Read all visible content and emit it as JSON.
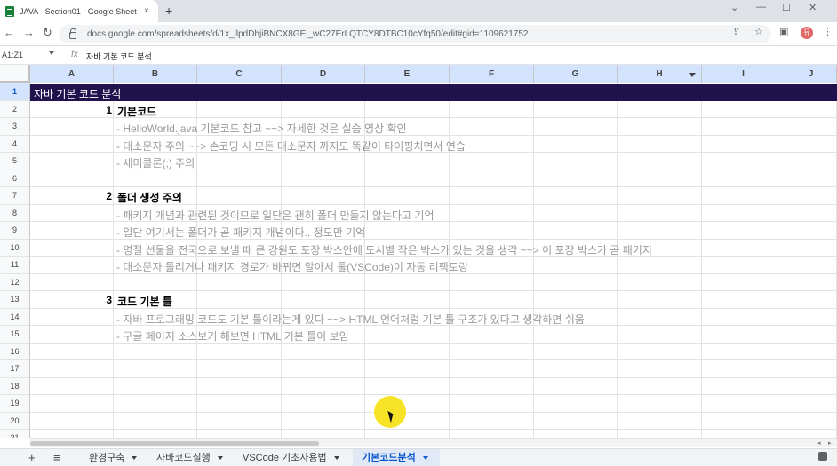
{
  "browser": {
    "tab_title": "JAVA - Section01 - Google Sheets",
    "tab_close": "×",
    "new_tab": "+",
    "url": "docs.google.com/spreadsheets/d/1x_llpdDhjiBNCX8GEi_wC27ErLQTCY8DTBC10cYfq50/edit#gid=1109621752",
    "profile_initial": "뮤"
  },
  "formula_bar": {
    "name_box": "A1:Z1",
    "fx": "fx",
    "value": "자바 기본 코드 분석"
  },
  "columns": [
    "A",
    "B",
    "C",
    "D",
    "E",
    "F",
    "G",
    "H",
    "I",
    "J"
  ],
  "rows": [
    "1",
    "2",
    "3",
    "4",
    "5",
    "6",
    "7",
    "8",
    "9",
    "10",
    "11",
    "12",
    "13",
    "14",
    "15",
    "16",
    "17",
    "18",
    "19",
    "20",
    "21"
  ],
  "sheet": {
    "title": "자바 기본 코드 분석",
    "sections": [
      {
        "number": "1",
        "heading": "기본코드",
        "items": [
          "- HelloWorld.java 기본코드 참고 ~~> 자세한 것은 실습 영상 확인",
          "- 대소문자 주의 ~~> 손코딩 시 모든 대소문자 까지도 똑같이 타이핑치면서 연습",
          "- 세미콜론(;) 주의"
        ]
      },
      {
        "number": "2",
        "heading": "폴더 생성 주의",
        "items": [
          "- 패키지 개념과 관련된 것이므로 일단은 괜히 폴더 만들지 않는다고 기억",
          "- 일단 여기서는 폴더가 곧 패키지 개념이다.. 정도만 기억",
          "- 명절 선물을 전국으로 보낼 때 큰 강원도 포장 박스안에 도시별 작은 박스가 있는 것을 생각 ~~> 이 포장 박스가 곧 패키지",
          "- 대소문자 틀리거나 패키지 경로가 바뀌면 알아서 툴(VSCode)이 자동 리팩토링"
        ]
      },
      {
        "number": "3",
        "heading": "코드 기본 틀",
        "items": [
          "- 자바 프로그래밍 코드도 기본 틀이라는게 있다 ~~> HTML 언어처럼 기본 틀 구조가 있다고 생각하면 쉬움",
          "- 구글 페이지 소스보기 해보면 HTML 기본 틀이 보임"
        ]
      }
    ]
  },
  "sheet_tabs": [
    {
      "label": "환경구축",
      "active": false
    },
    {
      "label": "자바코드실행",
      "active": false
    },
    {
      "label": "VSCode 기초사용법",
      "active": false
    },
    {
      "label": "기본코드분석",
      "active": true
    }
  ],
  "toolbar": {
    "add_sheet": "+",
    "all_sheets": "≡"
  },
  "colors": {
    "title_bg": "#20124d",
    "title_fg": "#ffffff",
    "item_text": "#999999",
    "selection": "#d3e3fd"
  }
}
